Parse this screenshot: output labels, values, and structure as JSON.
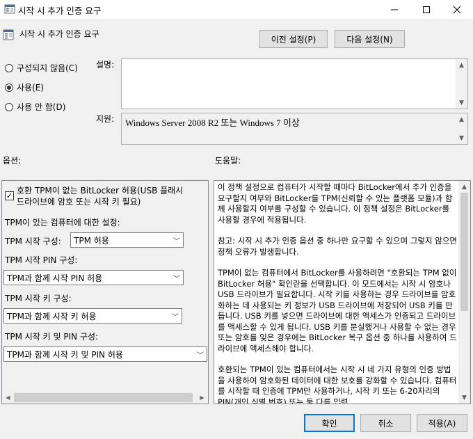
{
  "window": {
    "title": "시작 시 추가 인증 요구",
    "minimize_icon": "minimize-icon",
    "maximize_icon": "maximize-icon",
    "close_icon": "close-icon"
  },
  "header": {
    "policy_title": "시작 시 추가 인증 요구",
    "policy_icon": "policy-setting-icon",
    "prev_button": "이전 설정(P)",
    "next_button": "다음 설정(N)"
  },
  "state": {
    "options": [
      {
        "label": "구성되지 않음(C)",
        "selected": false
      },
      {
        "label": "사용(E)",
        "selected": true
      },
      {
        "label": "사용 안 함(D)",
        "selected": false
      }
    ]
  },
  "comment": {
    "label": "설명:",
    "value": ""
  },
  "supported": {
    "label": "지원:",
    "value": "Windows Server 2008 R2 또는 Windows 7 이상"
  },
  "options_panel": {
    "heading": "옵션:",
    "allow_no_tpm": {
      "checked": true,
      "line1": "호환 TPM이 없는 BitLocker 허용(USB 플래시",
      "line2": "드라이브에 암호 또는 시작 키 필요)"
    },
    "tpm_settings_label": "TPM이 있는 컴퓨터에 대한 설정:",
    "tpm_startup_label": "TPM 시작 구성:",
    "tpm_startup_value": "TPM 허용",
    "tpm_pin_label": "TPM 시작 PIN 구성:",
    "tpm_pin_value": "TPM과 함께 시작 PIN 허용",
    "tpm_key_label": "TPM 시작 키 구성:",
    "tpm_key_value": "TPM과 함께 시작 키 허용",
    "tpm_key_pin_label": "TPM 시작 키 및 PIN 구성:",
    "tpm_key_pin_value": "TPM과 함께 시작 키 및 PIN 허용"
  },
  "help_panel": {
    "heading": "도움말:",
    "paragraphs": [
      "이 정책 설정으로 컴퓨터가 시작할 때마다 BitLocker에서 추가 인증을 요구할지 여부와 BitLocker를 TPM(신뢰할 수 있는 플랫폼 모듈)과 함께 사용할지 여부를 구성할 수 있습니다. 이 정책 설정은 BitLocker를 사용할 경우에 적용됩니다.",
      "참고: 시작 시 추가 인증 옵션 중 하나만 요구할 수 있으며 그렇지 않으면 정책 오류가 발생합니다.",
      "TPM이 없는 컴퓨터에서 BitLocker를 사용하려면 \"호환되는 TPM 없이 BitLocker 허용\" 확인란을 선택합니다. 이 모드에서는 시작 시 암호나 USB 드라이브가 필요합니다. 시작 키를 사용하는 경우 드라이브를 암호화하는 데 사용되는 키 정보가 USB 드라이브에 저장되어 USB 키를 만듭니다. USB 키를 넣으면 드라이브에 대한 액세스가 인증되고 드라이브를 액세스할 수 있게 됩니다. USB 키를 분실했거나 사용할 수 없는 경우 또는 암호를 잊은 경우에는 BitLocker 복구 옵션 중 하나를 사용하여 드라이브에 액세스해야 합니다.",
      "호환되는 TPM이 있는 컴퓨터에서는 시작 시 네 가지 유형의 인증 방법을 사용하여 암호화된 데이터에 대한 보호를 강화할 수 있습니다. 컴퓨터를 시작할 때 인증에 TPM만 사용하거나, 시작 키 또는 6-20자리의 PIN(개인 식별 번호) 또는 둘 다를 입력"
    ]
  },
  "footer": {
    "ok": "확인",
    "cancel": "취소",
    "apply": "적용(A)"
  }
}
